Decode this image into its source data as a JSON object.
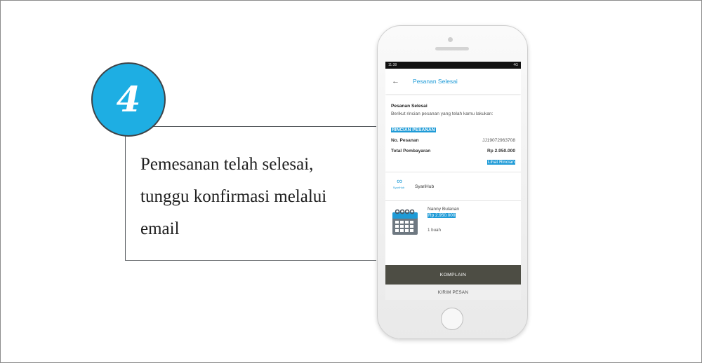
{
  "step": {
    "number": "4"
  },
  "callout": {
    "lines": [
      "Pemesanan telah selesai,",
      "tunggu konfirmasi melalui",
      "email"
    ]
  },
  "colors": {
    "accent": "#1eaee3",
    "link": "#1f9bd7",
    "button_dark": "#4d4d44"
  },
  "phone": {
    "status_bar": {
      "time": "11:38",
      "indicators": "4G"
    },
    "app_bar": {
      "back_icon": "arrow-left-icon",
      "title": "Pesanan Selesai"
    },
    "summary": {
      "title": "Pesanan Selesai",
      "description": "Berikut rincian pesanan yang telah kamu lakukan:"
    },
    "details": {
      "heading": "RINCIAN PESANAN",
      "order_label": "No. Pesanan",
      "order_value": "JJ19072963708",
      "total_label": "Total Pembayaran",
      "total_value": "Rp  2.950.000",
      "detail_link": "Lihat Rincian"
    },
    "shop": {
      "logo_icon": "syarihub-logo-icon",
      "logo_tag": "SyariHub",
      "name": "SyariHub"
    },
    "item": {
      "icon": "calendar-icon",
      "name": "Nanny Bulanan",
      "price": "Rp 2.950.000",
      "quantity": "1 buah"
    },
    "buttons": {
      "komplain": "KOMPLAIN",
      "kirim": "KIRIM PESAN"
    }
  }
}
